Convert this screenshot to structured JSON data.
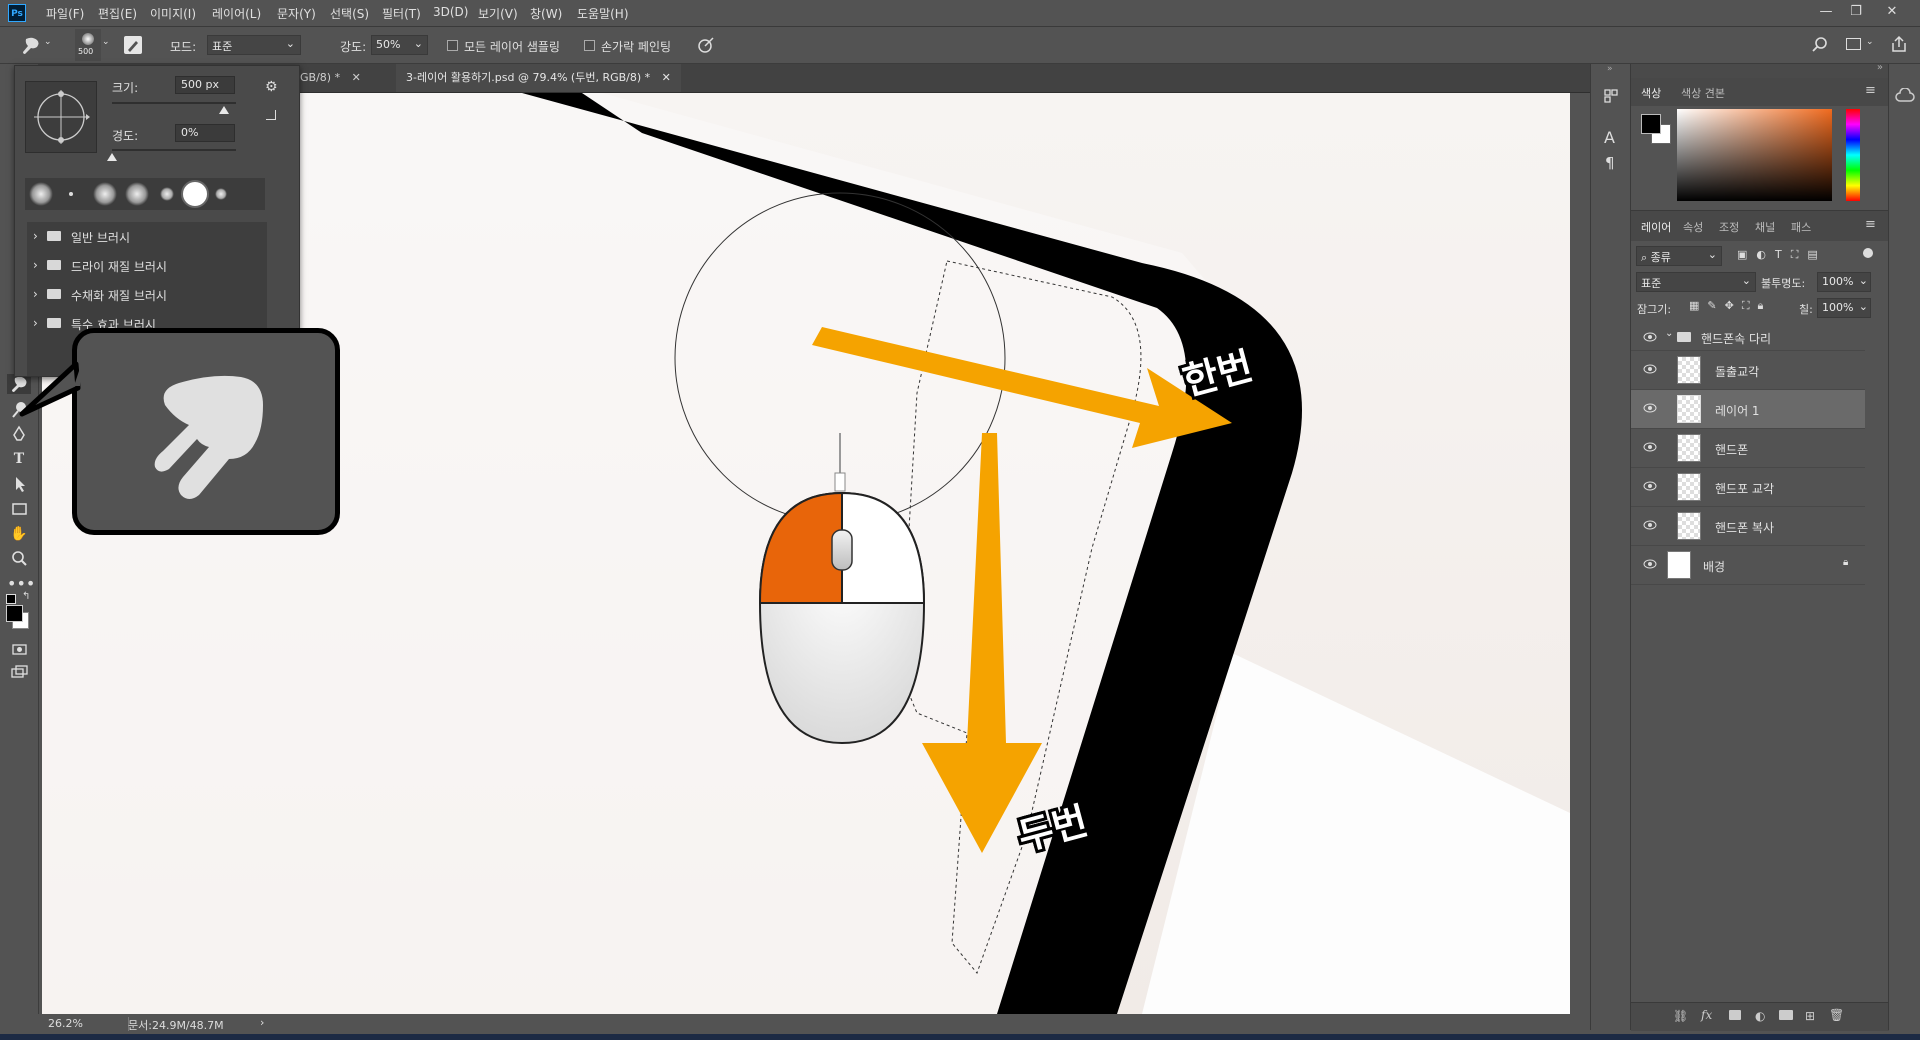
{
  "menu": [
    "파일(F)",
    "편집(E)",
    "이미지(I)",
    "레이어(L)",
    "문자(Y)",
    "선택(S)",
    "필터(T)",
    "3D(D)",
    "보기(V)",
    "창(W)",
    "도움말(H)"
  ],
  "app": {
    "logo": "Ps"
  },
  "options": {
    "brush_size_badge": "500",
    "mode_label": "모드:",
    "mode_value": "표준",
    "strength_label": "강도:",
    "strength_value": "50%",
    "sample_all_layers": "모든 레이어 샘플링",
    "finger_painting": "손가락 페인팅"
  },
  "brush_popup": {
    "size_label": "크기:",
    "size_value": "500 px",
    "hardness_label": "경도:",
    "hardness_value": "0%",
    "size_slider_fraction": 0.9,
    "hardness_slider_fraction": 0.0,
    "folders": [
      "일반 브러시",
      "드라이 재질 브러시",
      "수채화 재질 브러시",
      "특수 효과 브러시"
    ]
  },
  "tabs": [
    {
      "label": "GB/8) *",
      "active": false
    },
    {
      "label": "3-레이어 활용하기.psd @ 79.4% (두번, RGB/8) *",
      "active": true
    }
  ],
  "annotations": {
    "once": "한번",
    "twice": "두번"
  },
  "status": {
    "zoom": "26.2%",
    "doc": "문서:24.9M/48.7M"
  },
  "color_panel": {
    "tabs": [
      "색상",
      "색상 견본"
    ],
    "foreground": "#000000",
    "background": "#ffffff",
    "hue_color": "#f06a1e"
  },
  "layers_panel": {
    "tabs": [
      "레이어",
      "속성",
      "조정",
      "채널",
      "패스"
    ],
    "filter_label": "종류",
    "blend_mode": "표준",
    "opacity_label": "불투명도:",
    "opacity_value": "100%",
    "lock_label": "잠그기:",
    "fill_label": "칠:",
    "fill_value": "100%",
    "group": "핸드폰속 다리",
    "layers": [
      {
        "name": "돌출교각",
        "selected": false
      },
      {
        "name": "레이어 1",
        "selected": true
      },
      {
        "name": "핸드폰",
        "selected": false
      },
      {
        "name": "핸드포 교각",
        "selected": false
      },
      {
        "name": "핸드폰 복사",
        "selected": false
      }
    ],
    "background_layer": "배경"
  },
  "colors": {
    "accent_orange": "#f5a300",
    "mouse_orange": "#e8650a"
  }
}
